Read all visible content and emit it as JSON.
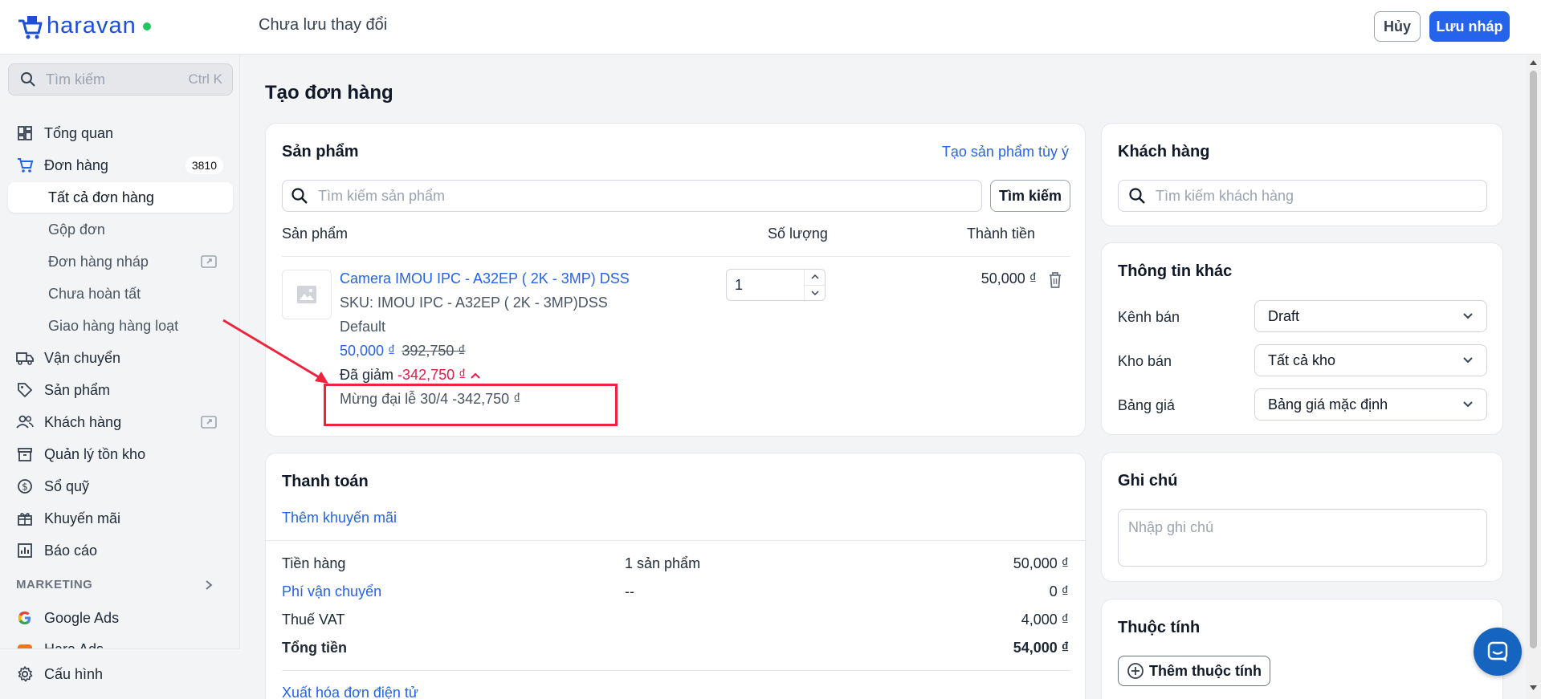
{
  "app": {
    "brand": "haravan",
    "status": "Chưa lưu thay đổi",
    "cancel_label": "Hủy",
    "save_label": "Lưu nháp"
  },
  "sidebar": {
    "search_placeholder": "Tìm kiếm",
    "search_shortcut": "Ctrl K",
    "items": [
      {
        "label": "Tổng quan",
        "icon": "dashboard-icon"
      },
      {
        "label": "Đơn hàng",
        "icon": "cart-icon",
        "badge": "3810"
      },
      {
        "label": "Tất cả đơn hàng"
      },
      {
        "label": "Gộp đơn"
      },
      {
        "label": "Đơn hàng nháp"
      },
      {
        "label": "Chưa hoàn tất"
      },
      {
        "label": "Giao hàng hàng loạt"
      },
      {
        "label": "Vận chuyển",
        "icon": "truck-icon"
      },
      {
        "label": "Sản phẩm",
        "icon": "tag-icon"
      },
      {
        "label": "Khách hàng",
        "icon": "users-icon"
      },
      {
        "label": "Quản lý tồn kho",
        "icon": "inventory-icon"
      },
      {
        "label": "Sổ quỹ",
        "icon": "dollar-icon"
      },
      {
        "label": "Khuyến mãi",
        "icon": "gift-icon"
      },
      {
        "label": "Báo cáo",
        "icon": "chart-icon"
      }
    ],
    "section_marketing": "MARKETING",
    "google_ads": "Google Ads",
    "hara_ads": "Hara Ads",
    "settings": "Cấu hình"
  },
  "page": {
    "title": "Tạo đơn hàng"
  },
  "products": {
    "title": "Sản phẩm",
    "custom_link": "Tạo sản phẩm tùy ý",
    "search_placeholder": "Tìm kiếm sản phẩm",
    "search_button": "Tìm kiếm",
    "col_product": "Sản phẩm",
    "col_qty": "Số lượng",
    "col_total": "Thành tiền",
    "item": {
      "name": "Camera IMOU IPC - A32EP ( 2K - 3MP) DSS",
      "sku": "SKU: IMOU IPC - A32EP ( 2K - 3MP)DSS",
      "variant": "Default",
      "price": "50,000 ₫",
      "original_price": "392,750 ₫",
      "discount_label": "Đã giảm",
      "discount_value": "-342,750 ₫",
      "promo_line": "Mừng đại lễ 30/4 -342,750 ₫",
      "qty": "1",
      "total": "50,000 ₫"
    }
  },
  "payment": {
    "title": "Thanh toán",
    "add_promo": "Thêm khuyến mãi",
    "rows": [
      {
        "label": "Tiền hàng",
        "mid": "1 sản phẩm",
        "value": "50,000 ₫"
      },
      {
        "label": "Phí vận chuyển",
        "mid": "--",
        "value": "0 ₫"
      },
      {
        "label": "Thuế VAT",
        "mid": "",
        "value": "4,000 ₫"
      },
      {
        "label": "Tổng tiền",
        "mid": "",
        "value": "54,000 ₫"
      }
    ],
    "einvoice": "Xuất hóa đơn điện tử"
  },
  "customer": {
    "title": "Khách hàng",
    "search_placeholder": "Tìm kiếm khách hàng"
  },
  "other_info": {
    "title": "Thông tin khác",
    "fields": [
      {
        "label": "Kênh bán",
        "value": "Draft"
      },
      {
        "label": "Kho bán",
        "value": "Tất cả kho"
      },
      {
        "label": "Bảng giá",
        "value": "Bảng giá mặc định"
      }
    ]
  },
  "note": {
    "title": "Ghi chú",
    "placeholder": "Nhập ghi chú"
  },
  "attributes": {
    "title": "Thuộc tính",
    "add_button": "Thêm thuộc tính"
  },
  "colors": {
    "accent": "#2563eb",
    "discount": "#e11d48",
    "annotation": "#ef233c"
  }
}
